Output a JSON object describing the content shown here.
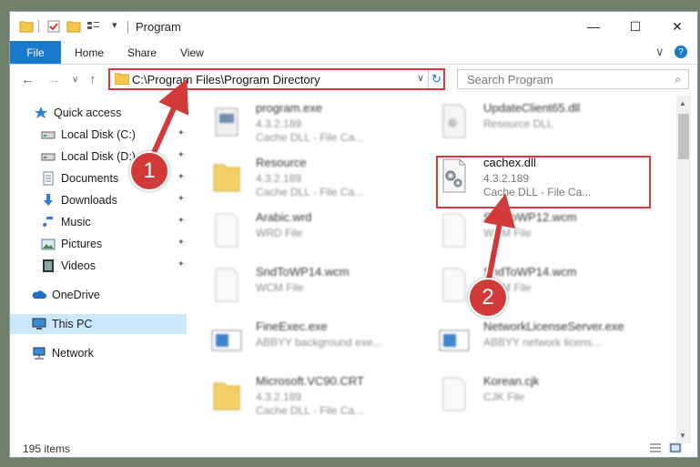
{
  "window": {
    "title": "Program",
    "controls": {
      "minimize": "—",
      "maximize": "☐",
      "close": "✕"
    }
  },
  "ribbon": {
    "tabs": [
      "File",
      "Home",
      "Share",
      "View"
    ],
    "collapse_glyph": "∨",
    "help_glyph": "?"
  },
  "nav": {
    "back": "←",
    "forward": "→",
    "recent": "∨",
    "up": "↑",
    "address": "C:\\Program Files\\Program Directory",
    "address_dropdown": "∨",
    "refresh": "↻",
    "search_placeholder": "Search Program",
    "search_glyph": "⌕"
  },
  "sidebar": {
    "items": [
      {
        "label": "Quick access",
        "icon": "star-icon",
        "pinned": false
      },
      {
        "label": "Local Disk (C:)",
        "icon": "drive-icon",
        "pinned": true
      },
      {
        "label": "Local Disk (D:)",
        "icon": "drive-icon",
        "pinned": true
      },
      {
        "label": "Documents",
        "icon": "documents-icon",
        "pinned": true
      },
      {
        "label": "Downloads",
        "icon": "download-icon",
        "pinned": true
      },
      {
        "label": "Music",
        "icon": "music-icon",
        "pinned": true
      },
      {
        "label": "Pictures",
        "icon": "pictures-icon",
        "pinned": true
      },
      {
        "label": "Videos",
        "icon": "videos-icon",
        "pinned": true
      },
      {
        "label": "OneDrive",
        "icon": "cloud-icon",
        "pinned": false
      },
      {
        "label": "This PC",
        "icon": "computer-icon",
        "pinned": false,
        "selected": true
      },
      {
        "label": "Network",
        "icon": "network-icon",
        "pinned": false
      }
    ],
    "pin_glyph": "📌"
  },
  "files": [
    {
      "name": "program.exe",
      "version": "4.3.2.189",
      "type": "Cache DLL - File Ca...",
      "icon": "exe-icon"
    },
    {
      "name": "UpdateClient65.dll",
      "version": "",
      "type": "Resource DLL",
      "icon": "dll-icon"
    },
    {
      "name": "Resource",
      "version": "4.3.2.189",
      "type": "Cache DLL - File Ca...",
      "icon": "folder-icon"
    },
    {
      "name": "cachex.dll",
      "version": "4.3.2.189",
      "type": "Cache DLL - File Ca...",
      "icon": "dll-gear-icon",
      "highlighted": true
    },
    {
      "name": "Arabic.wrd",
      "version": "",
      "type": "WRD File",
      "icon": "blank-file-icon"
    },
    {
      "name": "SndToWP12.wcm",
      "version": "",
      "type": "WCM File",
      "icon": "blank-file-icon"
    },
    {
      "name": "SndToWP14.wcm",
      "version": "",
      "type": "WCM File",
      "icon": "blank-file-icon"
    },
    {
      "name": "SndToWP14.wcm",
      "version": "",
      "type": "WCM File",
      "icon": "blank-file-icon"
    },
    {
      "name": "FineExec.exe",
      "version": "",
      "type": "ABBYY background exe...",
      "icon": "app-icon"
    },
    {
      "name": "NetworkLicenseServer.exe",
      "version": "",
      "type": "ABBYY network licens...",
      "icon": "app-icon"
    },
    {
      "name": "Microsoft.VC90.CRT",
      "version": "4.3.2.189",
      "type": "Cache DLL - File Ca...",
      "icon": "folder-icon"
    },
    {
      "name": "Korean.cjk",
      "version": "",
      "type": "CJK File",
      "icon": "blank-file-icon"
    }
  ],
  "status": {
    "count": "195 items"
  },
  "callouts": [
    "1",
    "2"
  ],
  "colors": {
    "accent": "#1979ca",
    "highlight": "#d9363e",
    "selected": "#cce8ff",
    "callout": "#d23a3a"
  }
}
